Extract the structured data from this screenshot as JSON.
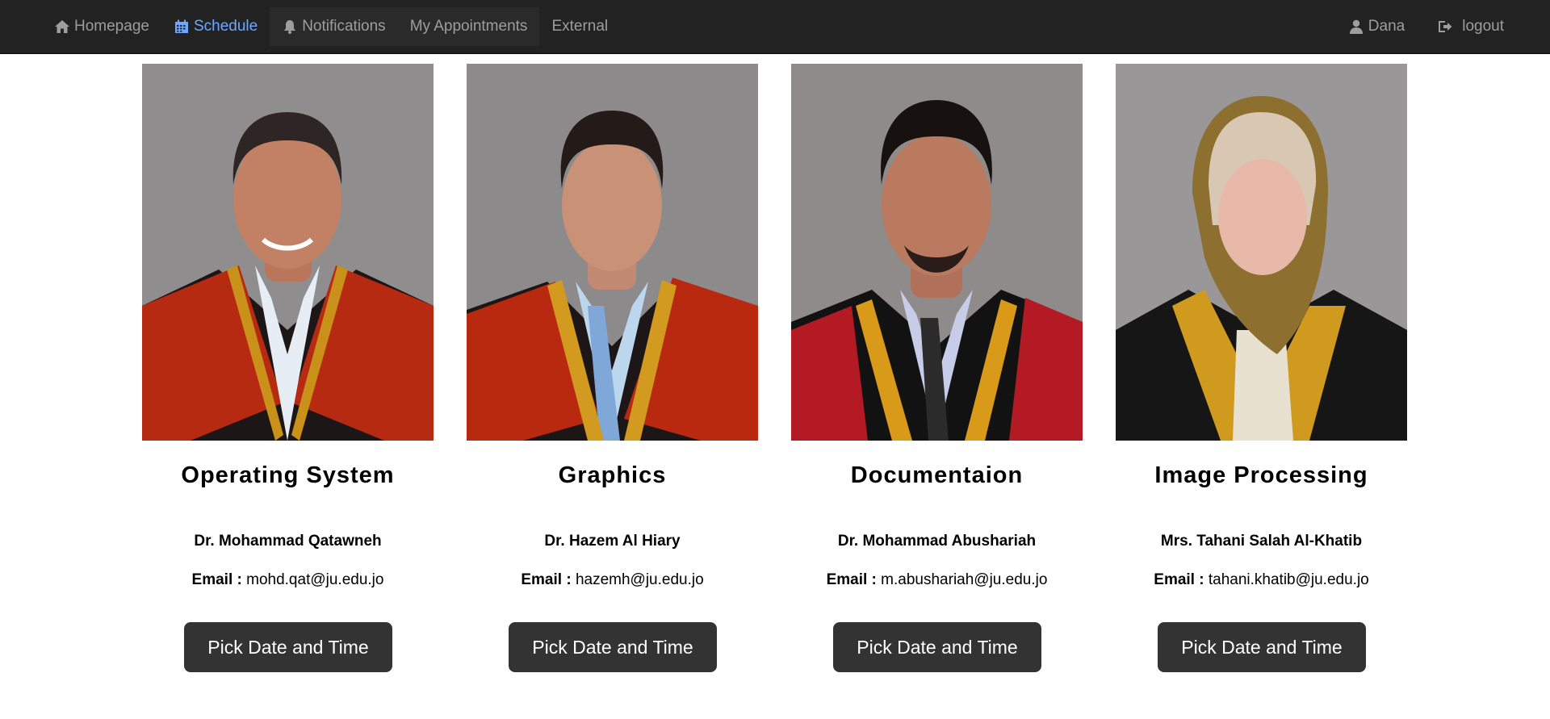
{
  "nav": {
    "left": [
      {
        "label": "Homepage",
        "icon": "home-icon"
      },
      {
        "label": "Schedule",
        "icon": "calendar-icon"
      },
      {
        "label": "Notifications",
        "icon": "bell-icon"
      },
      {
        "label": "My Appointments"
      },
      {
        "label": "External"
      }
    ],
    "right": [
      {
        "label": "Dana",
        "icon": "user-icon"
      },
      {
        "label": "logout",
        "icon": "logout-icon"
      }
    ],
    "active_color": "#6ea8fe",
    "text_color": "#9d9d9d",
    "bar_color": "#222222"
  },
  "courses": [
    {
      "course": "Operating System",
      "professor": "Dr. Mohammad Qatawneh",
      "email_label": "Email :",
      "email": "mohd.qat@ju.edu.jo",
      "button": "Pick Date and Time",
      "robe": "#b52a10",
      "trim": "#c9901a"
    },
    {
      "course": "Graphics",
      "professor": "Dr. Hazem Al Hiary",
      "email_label": "Email :",
      "email": "hazemh@ju.edu.jo",
      "button": "Pick Date and Time",
      "robe": "#b8290f",
      "trim": "#d29a1f"
    },
    {
      "course": "Documentaion",
      "professor": "Dr. Mohammad Abushariah",
      "email_label": "Email :",
      "email": "m.abushariah@ju.edu.jo",
      "button": "Pick Date and Time",
      "robe": "#b31a24",
      "trim": "#d99a1a"
    },
    {
      "course": "Image Processing",
      "professor": "Mrs. Tahani Salah Al-Khatib",
      "email_label": "Email :",
      "email": "tahani.khatib@ju.edu.jo",
      "button": "Pick Date and Time",
      "robe": "#1a1a1a",
      "trim": "#cf9a1e"
    }
  ]
}
